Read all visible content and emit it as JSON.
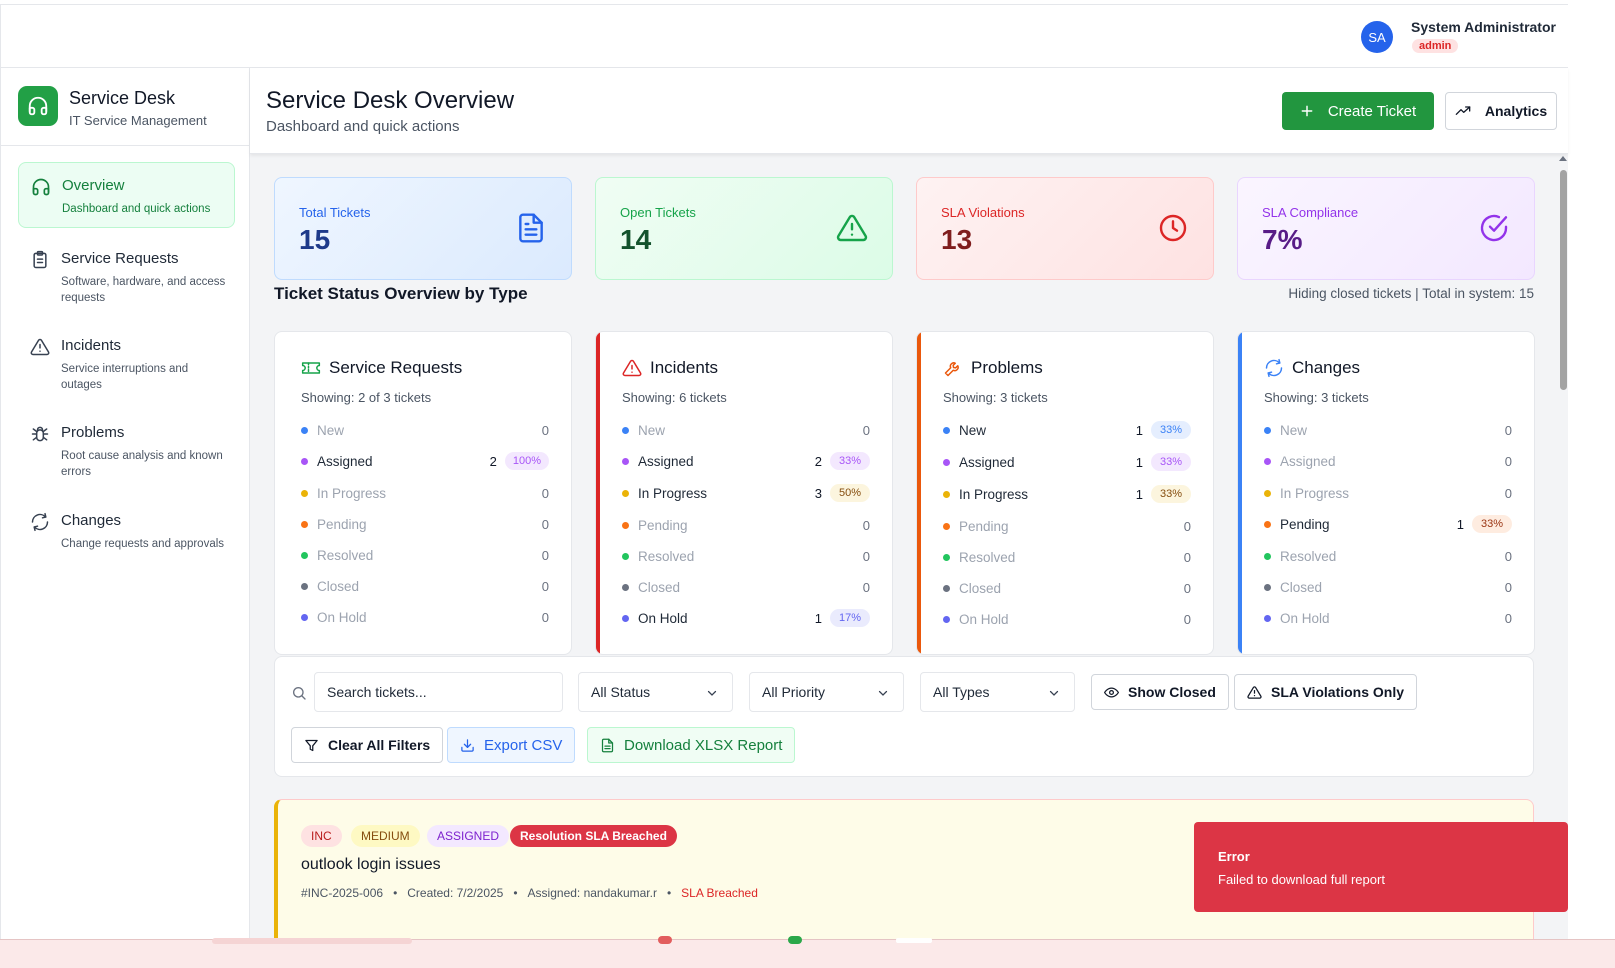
{
  "user": {
    "initials": "SA",
    "name": "System Administrator",
    "role": "admin"
  },
  "brand": {
    "title": "Service Desk",
    "subtitle": "IT Service Management"
  },
  "nav": [
    {
      "label": "Overview",
      "desc": "Dashboard and quick actions",
      "icon": "headphones-icon",
      "active": true
    },
    {
      "label": "Service Requests",
      "desc": "Software, hardware, and access requests",
      "icon": "clipboard-icon"
    },
    {
      "label": "Incidents",
      "desc": "Service interruptions and outages",
      "icon": "warning-icon"
    },
    {
      "label": "Problems",
      "desc": "Root cause analysis and known errors",
      "icon": "bug-icon"
    },
    {
      "label": "Changes",
      "desc": "Change requests and approvals",
      "icon": "refresh-icon"
    }
  ],
  "header": {
    "title": "Service Desk Overview",
    "subtitle": "Dashboard and quick actions",
    "create_label": "Create Ticket",
    "analytics_label": "Analytics"
  },
  "stats": [
    {
      "label": "Total Tickets",
      "value": "15",
      "icon": "document-icon",
      "color": "#2563eb"
    },
    {
      "label": "Open Tickets",
      "value": "14",
      "icon": "warning-icon",
      "color": "#16a34a"
    },
    {
      "label": "SLA Violations",
      "value": "13",
      "icon": "clock-icon",
      "color": "#dc2626"
    },
    {
      "label": "SLA Compliance",
      "value": "7%",
      "icon": "check-circle-icon",
      "color": "#9333ea"
    }
  ],
  "overview": {
    "title": "Ticket Status Overview by Type",
    "meta": "Hiding closed tickets | Total in system: 15"
  },
  "status_names": [
    "New",
    "Assigned",
    "In Progress",
    "Pending",
    "Resolved",
    "Closed",
    "On Hold"
  ],
  "status_colors": [
    "#3b82f6",
    "#a855f7",
    "#eab308",
    "#f97316",
    "#22c55e",
    "#6b7280",
    "#6366f1"
  ],
  "type_cards": [
    {
      "title": "Service Requests",
      "showing": "Showing: 2 of 3 tickets",
      "icon": "ticket-icon",
      "accent": "",
      "counts": [
        {
          "count": "0",
          "pct": ""
        },
        {
          "count": "2",
          "pct": "100%"
        },
        {
          "count": "0",
          "pct": ""
        },
        {
          "count": "0",
          "pct": ""
        },
        {
          "count": "0",
          "pct": ""
        },
        {
          "count": "0",
          "pct": ""
        },
        {
          "count": "0",
          "pct": ""
        }
      ]
    },
    {
      "title": "Incidents",
      "showing": "Showing: 6 tickets",
      "icon": "warning-icon",
      "accent": "#dc2626",
      "counts": [
        {
          "count": "0",
          "pct": ""
        },
        {
          "count": "2",
          "pct": "33%"
        },
        {
          "count": "3",
          "pct": "50%"
        },
        {
          "count": "0",
          "pct": ""
        },
        {
          "count": "0",
          "pct": ""
        },
        {
          "count": "0",
          "pct": ""
        },
        {
          "count": "1",
          "pct": "17%"
        }
      ]
    },
    {
      "title": "Problems",
      "showing": "Showing: 3 tickets",
      "icon": "wrench-icon",
      "accent": "#ea580c",
      "counts": [
        {
          "count": "1",
          "pct": "33%"
        },
        {
          "count": "1",
          "pct": "33%"
        },
        {
          "count": "1",
          "pct": "33%"
        },
        {
          "count": "0",
          "pct": ""
        },
        {
          "count": "0",
          "pct": ""
        },
        {
          "count": "0",
          "pct": ""
        },
        {
          "count": "0",
          "pct": ""
        }
      ]
    },
    {
      "title": "Changes",
      "showing": "Showing: 3 tickets",
      "icon": "refresh-icon",
      "accent": "#3b82f6",
      "counts": [
        {
          "count": "0",
          "pct": ""
        },
        {
          "count": "0",
          "pct": ""
        },
        {
          "count": "0",
          "pct": ""
        },
        {
          "count": "1",
          "pct": "33%"
        },
        {
          "count": "0",
          "pct": ""
        },
        {
          "count": "0",
          "pct": ""
        },
        {
          "count": "0",
          "pct": ""
        }
      ]
    }
  ],
  "filters": {
    "search_placeholder": "Search tickets...",
    "status": "All Status",
    "priority": "All Priority",
    "types": "All Types",
    "show_closed": "Show Closed",
    "sla_only": "SLA Violations Only",
    "clear": "Clear All Filters",
    "export_csv": "Export CSV",
    "download_xlsx": "Download XLSX Report"
  },
  "ticket": {
    "badges": [
      "INC",
      "MEDIUM",
      "ASSIGNED",
      "Resolution SLA Breached"
    ],
    "title": "outlook login issues",
    "id": "#INC-2025-006",
    "created": "Created: 7/2/2025",
    "assigned": "Assigned: nandakumar.r",
    "breach": "SLA Breached"
  },
  "toast": {
    "title": "Error",
    "message": "Failed to download full report"
  }
}
